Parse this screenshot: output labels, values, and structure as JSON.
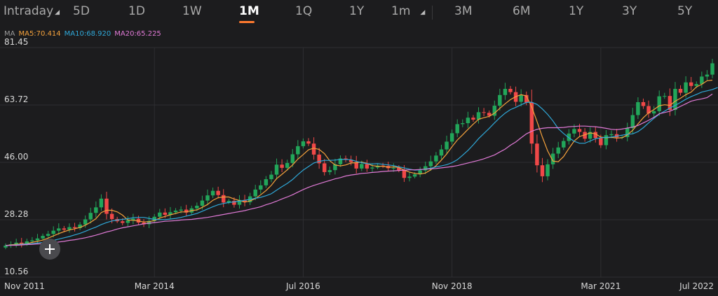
{
  "tabs": {
    "items": [
      {
        "label": "Intraday",
        "dropdown": true,
        "active": false
      },
      {
        "label": "5D",
        "dropdown": false,
        "active": false
      },
      {
        "label": "1D",
        "dropdown": false,
        "active": false
      },
      {
        "label": "1W",
        "dropdown": false,
        "active": false
      },
      {
        "label": "1M",
        "dropdown": false,
        "active": true
      },
      {
        "label": "1Q",
        "dropdown": false,
        "active": false
      },
      {
        "label": "1Y",
        "dropdown": false,
        "active": false
      },
      {
        "label": "1m",
        "dropdown": true,
        "active": false
      },
      {
        "label": "3M",
        "dropdown": false,
        "active": false
      },
      {
        "label": "6M",
        "dropdown": false,
        "active": false
      },
      {
        "label": "1Y",
        "dropdown": false,
        "active": false
      },
      {
        "label": "3Y",
        "dropdown": false,
        "active": false
      },
      {
        "label": "5Y",
        "dropdown": false,
        "active": false
      }
    ],
    "accent_color": "#ff7a2f"
  },
  "legend": {
    "prefix": "MA",
    "ma5": "MA5:70.414",
    "ma10": "MA10:68.920",
    "ma20": "MA20:65.225"
  },
  "colors": {
    "up": "#22a65a",
    "down": "#f04848",
    "ma5": "#f5a23c",
    "ma10": "#2fa8d8",
    "ma20": "#e07ad6",
    "grid": "#2e2e31",
    "axis_text": "#d8d8d8"
  },
  "icons": {
    "crosshair": "crosshair-plus-icon"
  },
  "chart_data": {
    "type": "candlestick",
    "interval": "1M",
    "y_ticks": [
      "81.45",
      "63.72",
      "46.00",
      "28.28",
      "10.56"
    ],
    "ylim": [
      10.56,
      81.45
    ],
    "grid": true,
    "x_ticks": [
      {
        "label": "Nov 2011",
        "index": 0
      },
      {
        "label": "Mar 2014",
        "index": 28
      },
      {
        "label": "Jul 2016",
        "index": 56
      },
      {
        "label": "Nov 2018",
        "index": 84
      },
      {
        "label": "Mar 2021",
        "index": 112
      },
      {
        "label": "Jul 2022",
        "index": 128
      }
    ],
    "close": [
      20.3,
      20.7,
      21.2,
      20.9,
      21.6,
      21.9,
      22.5,
      23.3,
      23.9,
      24.9,
      25.6,
      25.2,
      26.0,
      25.7,
      26.8,
      28.4,
      30.4,
      32.1,
      34.8,
      30.1,
      28.5,
      27.8,
      27.3,
      28.1,
      28.6,
      27.4,
      26.9,
      27.9,
      29.2,
      30.5,
      29.8,
      30.6,
      31.1,
      31.4,
      30.5,
      31.8,
      32.6,
      34.2,
      35.8,
      37.2,
      35.9,
      33.6,
      34.1,
      32.9,
      34.4,
      33.7,
      35.5,
      37.6,
      38.9,
      40.8,
      42.2,
      45.3,
      44.3,
      45.8,
      48.5,
      51.0,
      52.5,
      51.8,
      48.4,
      45.7,
      43.0,
      43.6,
      45.4,
      47.2,
      46.8,
      46.1,
      44.1,
      45.5,
      44.1,
      44.4,
      45.0,
      44.9,
      44.2,
      44.3,
      43.6,
      41.2,
      41.6,
      42.3,
      43.5,
      44.8,
      46.3,
      48.1,
      50.0,
      52.4,
      55.0,
      57.8,
      58.1,
      59.8,
      59.2,
      61.5,
      61.3,
      60.4,
      63.5,
      66.8,
      68.7,
      67.7,
      64.7,
      66.8,
      64.5,
      51.8,
      45.1,
      41.7,
      45.4,
      48.7,
      50.6,
      52.6,
      54.9,
      56.3,
      55.4,
      53.3,
      55.4,
      53.5,
      51.3,
      54.4,
      54.7,
      53.7,
      53.8,
      56.6,
      60.6,
      64.6,
      63.4,
      61.1,
      61.8,
      66.4,
      66.5,
      62.2,
      68.7,
      67.5,
      70.7,
      69.6,
      70.2,
      72.5,
      73.1,
      76.6
    ],
    "series": [
      {
        "name": "MA5",
        "values": [
          20.3,
          20.5,
          20.7,
          20.8,
          20.9,
          21.3,
          21.6,
          22.0,
          22.6,
          23.3,
          24.0,
          24.6,
          25.1,
          25.5,
          25.9,
          26.6,
          27.5,
          28.6,
          30.5,
          31.2,
          31.2,
          30.7,
          29.7,
          28.2,
          28.1,
          27.9,
          27.6,
          27.7,
          28.0,
          28.8,
          29.3,
          29.8,
          30.2,
          30.7,
          30.7,
          31.1,
          31.3,
          32.1,
          33.0,
          34.3,
          35.1,
          35.3,
          35.3,
          34.7,
          34.2,
          33.7,
          34.1,
          34.8,
          36.0,
          37.3,
          38.9,
          41.0,
          42.3,
          43.7,
          45.2,
          47.0,
          48.4,
          49.9,
          50.4,
          50.0,
          48.7,
          46.5,
          45.2,
          44.9,
          45.2,
          45.8,
          45.9,
          46.1,
          45.7,
          45.0,
          44.8,
          44.8,
          44.5,
          44.6,
          44.4,
          43.6,
          43.0,
          42.6,
          42.4,
          42.7,
          43.7,
          45.0,
          46.7,
          48.6,
          50.8,
          52.9,
          54.5,
          56.2,
          57.8,
          59.3,
          59.8,
          60.2,
          61.2,
          62.7,
          64.1,
          65.4,
          66.3,
          66.9,
          66.5,
          63.1,
          58.6,
          53.8,
          49.5,
          46.4,
          46.2,
          47.8,
          50.3,
          52.6,
          54.0,
          54.5,
          55.1,
          54.8,
          53.8,
          53.6,
          53.7,
          53.5,
          53.6,
          54.5,
          55.9,
          57.9,
          59.8,
          61.3,
          62.3,
          63.5,
          63.8,
          63.6,
          64.9,
          65.8,
          66.9,
          67.7,
          69.3,
          70.1,
          71.2,
          71.4
        ]
      },
      {
        "name": "MA10",
        "values": [
          20.3,
          20.4,
          20.5,
          20.7,
          20.8,
          20.9,
          21.1,
          21.3,
          21.6,
          21.9,
          22.3,
          22.7,
          23.1,
          23.6,
          24.1,
          24.7,
          25.4,
          26.0,
          26.8,
          27.4,
          27.9,
          28.2,
          28.4,
          28.6,
          28.9,
          29.0,
          29.0,
          28.7,
          28.4,
          28.3,
          28.3,
          28.5,
          28.7,
          29.0,
          29.4,
          29.8,
          30.2,
          30.9,
          31.6,
          32.3,
          32.9,
          33.3,
          33.6,
          33.8,
          34.0,
          34.3,
          34.6,
          34.9,
          35.2,
          35.7,
          36.3,
          37.4,
          38.5,
          39.5,
          40.7,
          42.2,
          43.6,
          44.7,
          45.8,
          46.3,
          46.6,
          46.6,
          46.7,
          46.9,
          46.9,
          46.8,
          46.3,
          45.9,
          45.6,
          45.5,
          45.6,
          45.4,
          45.2,
          45.0,
          44.6,
          44.3,
          43.9,
          43.6,
          43.7,
          43.9,
          44.2,
          44.6,
          44.9,
          45.3,
          45.9,
          46.8,
          48.2,
          49.7,
          51.4,
          53.3,
          54.9,
          56.5,
          58.2,
          59.8,
          61.2,
          62.3,
          63.0,
          63.8,
          64.5,
          64.6,
          63.9,
          62.5,
          60.8,
          58.8,
          56.4,
          54.9,
          53.6,
          52.5,
          51.9,
          51.9,
          52.6,
          53.3,
          53.6,
          53.7,
          53.8,
          54.1,
          54.4,
          54.7,
          54.8,
          55.5,
          56.7,
          58.2,
          59.6,
          60.9,
          61.8,
          62.8,
          63.6,
          64.5,
          65.5,
          66.3,
          67.0,
          67.7,
          68.1,
          68.5,
          69.1
        ]
      },
      {
        "name": "MA20",
        "values": [
          20.3,
          20.4,
          20.4,
          20.5,
          20.6,
          20.7,
          20.8,
          20.9,
          21.1,
          21.2,
          21.4,
          21.6,
          21.9,
          22.1,
          22.4,
          22.7,
          23.1,
          23.5,
          24.0,
          24.5,
          24.9,
          25.4,
          25.8,
          26.1,
          26.4,
          26.7,
          27.0,
          27.2,
          27.4,
          27.6,
          27.8,
          27.9,
          28.0,
          28.2,
          28.3,
          28.4,
          28.6,
          28.8,
          29.0,
          29.3,
          29.6,
          29.9,
          30.2,
          30.5,
          30.8,
          31.1,
          31.5,
          31.9,
          32.3,
          32.9,
          33.4,
          34.0,
          34.7,
          35.3,
          36.0,
          36.8,
          37.6,
          38.3,
          38.9,
          39.4,
          39.9,
          40.4,
          40.9,
          41.3,
          41.8,
          42.1,
          42.3,
          42.6,
          42.7,
          42.9,
          43.0,
          43.2,
          43.3,
          43.4,
          43.5,
          43.6,
          43.7,
          43.7,
          43.8,
          43.9,
          44.0,
          44.1,
          44.3,
          44.5,
          44.7,
          45.0,
          45.4,
          45.8,
          46.2,
          46.6,
          47.1,
          47.7,
          48.3,
          49.2,
          50.1,
          51.3,
          52.3,
          53.6,
          54.8,
          55.6,
          56.2,
          56.5,
          56.7,
          56.7,
          56.7,
          56.8,
          57.0,
          57.1,
          57.2,
          57.2,
          57.1,
          57.0,
          56.8,
          56.5,
          56.2,
          56.1,
          56.3,
          56.6,
          56.9,
          57.4,
          58.2,
          59.0,
          59.9,
          61.0,
          61.4,
          61.8,
          62.5,
          63.3,
          64.1,
          64.9,
          65.3,
          65.6,
          66.0,
          67.1
        ]
      }
    ]
  }
}
